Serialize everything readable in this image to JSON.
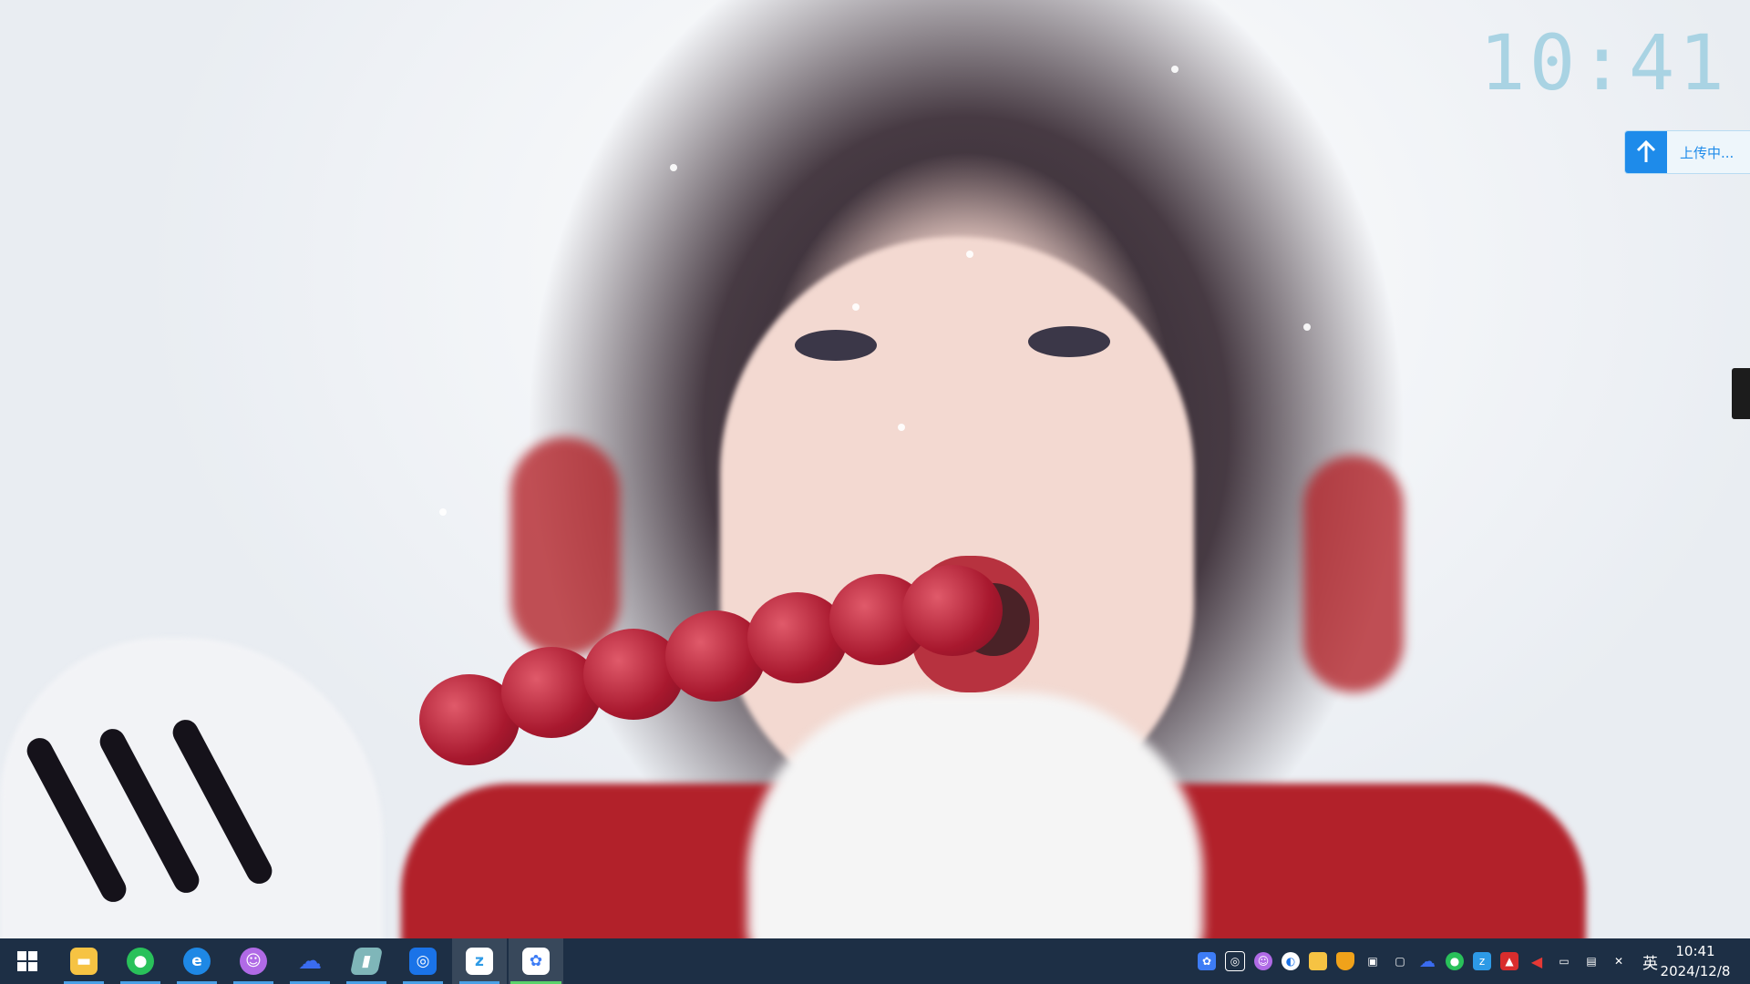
{
  "desktop": {
    "clock_widget": "10:41",
    "upload_widget": {
      "status_text": "上传中...",
      "icon": "arrow-up-icon"
    }
  },
  "taskbar": {
    "start": {
      "icon": "windows-start-icon"
    },
    "pinned_apps": [
      {
        "name": "File Explorer",
        "icon": "folder-icon",
        "color": "#f6c343",
        "running": true
      },
      {
        "name": "WeChat",
        "icon": "wechat-icon",
        "color": "#29c15a",
        "running": true
      },
      {
        "name": "Microsoft Edge",
        "icon": "edge-icon",
        "color": "#1e88e5",
        "running": true
      },
      {
        "name": "Cat App",
        "icon": "cat-icon",
        "color": "#b06ae6",
        "running": true
      },
      {
        "name": "Cloud Drive",
        "icon": "cloud-icon",
        "color": "#3a6cf0",
        "running": true
      },
      {
        "name": "Notes",
        "icon": "notes-icon",
        "color": "#7fb6b9",
        "running": true
      },
      {
        "name": "Screen Capture",
        "icon": "capture-icon",
        "color": "#1a73e8",
        "running": true
      },
      {
        "name": "Browser",
        "icon": "browser-icon",
        "color": "#2d9ae6",
        "running": true
      },
      {
        "name": "Baidu Netdisk",
        "icon": "netdisk-icon",
        "color": "#3d7cf5",
        "running": true,
        "current": true
      }
    ],
    "tray_icons": [
      "netdisk-tray-icon",
      "capture-tray-icon",
      "cat-tray-icon",
      "app-tray-icon",
      "folder-tray-icon",
      "shield-tray-icon",
      "display-tray-icon",
      "window-tray-icon",
      "cloud-tray-icon",
      "wechat-tray-icon",
      "browser-tray-icon",
      "red-app-tray-icon",
      "speaker-tray-icon",
      "battery-tray-icon",
      "network-tray-icon",
      "mute-tray-icon"
    ],
    "ime": "英",
    "time": "10:41",
    "date": "2024/12/8"
  }
}
